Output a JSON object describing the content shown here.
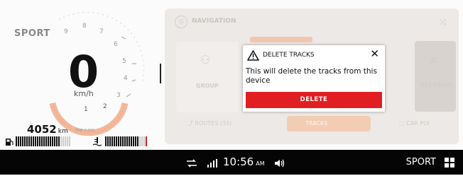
{
  "cluster": {
    "ride_mode": "SPORT",
    "speed": "0",
    "speed_unit": "km/h",
    "odometer": "4052",
    "odometer_unit": "km",
    "odometer_small": "TRIP 0.000",
    "tach_labels": [
      "1",
      "2",
      "3",
      "4",
      "5",
      "6",
      "7",
      "8",
      "9"
    ]
  },
  "panel": {
    "title": "NAVIGATION",
    "tile_group_label": "GROUP",
    "tile_settings_label": "SETTINGS",
    "tab_routes": "ROUTES (33)",
    "tab_tracks": "TRACKS",
    "tab_poi": "CAR POI"
  },
  "dialog": {
    "title": "DELETE TRACKS",
    "message": "This will delete the tracks from this device",
    "delete_label": "DELETE",
    "close_glyph": "✕"
  },
  "statusbar": {
    "time": "10:56",
    "ampm": "AM",
    "mode": "SPORT"
  },
  "icons": {
    "warning": "warning-icon",
    "close": "close-icon",
    "fuel": "fuel-icon",
    "temp": "coolant-temp-icon",
    "signal": "signal-icon",
    "volume": "volume-icon",
    "menu": "grid-menu-icon"
  },
  "colors": {
    "accent_red": "#e11f22",
    "tracks_tab": "#f3ccb4",
    "statusbar_bg": "#050505"
  },
  "gauges": {
    "fuel_level": 0.82,
    "temp_level": 0.78
  }
}
